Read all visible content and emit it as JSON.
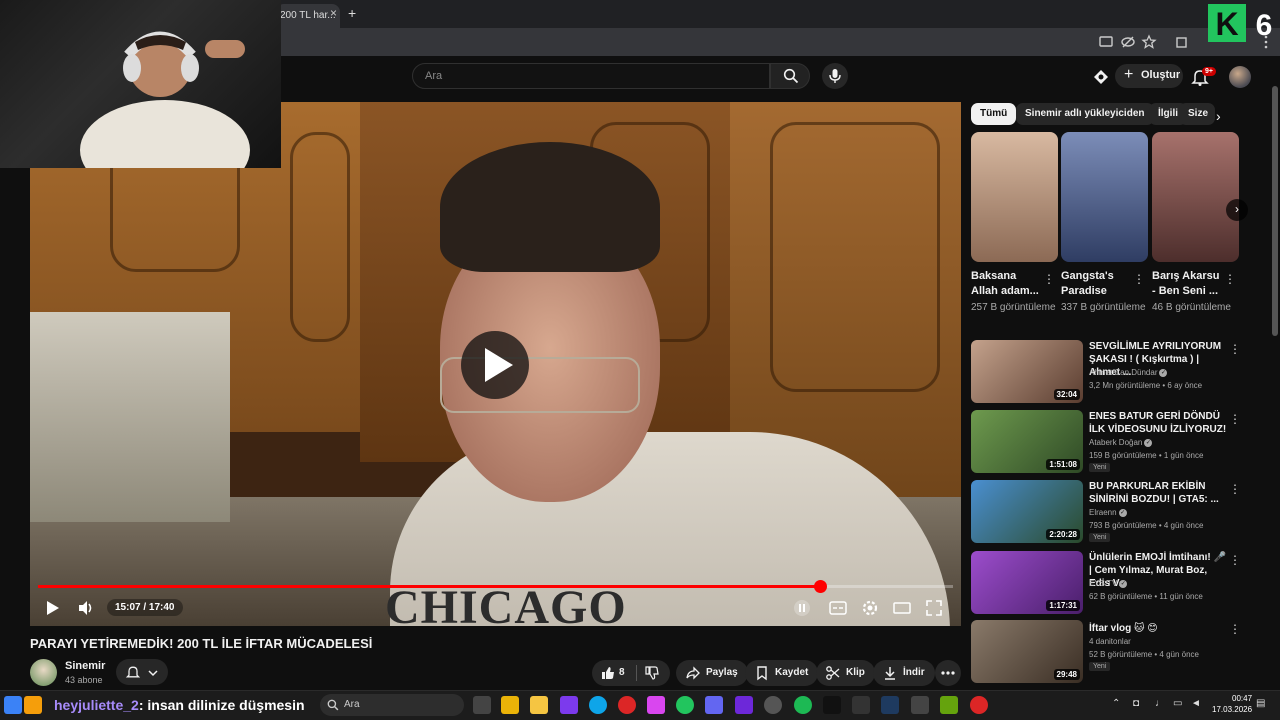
{
  "browser": {
    "tab_title": "200 TL har...",
    "tab_close": "×",
    "new_tab": "+"
  },
  "header": {
    "search_placeholder": "Ara",
    "create_label": "Oluştur",
    "notification_count": "9+"
  },
  "overlay": {
    "k6_letter": "K",
    "k6_number": "6"
  },
  "player": {
    "time": "15:07 / 17:40",
    "progress_fraction": 0.855,
    "shirt_text": "CHICAGO"
  },
  "video": {
    "title": "PARAYI YETİREMEDİK! 200 TL İLE İFTAR MÜCADELESİ",
    "channel": "Sinemir",
    "subscribers": "43 abone",
    "like_count": "8",
    "share_label": "Paylaş",
    "save_label": "Kaydet",
    "clip_label": "Klip",
    "download_label": "İndir"
  },
  "sidebar": {
    "chips": [
      "Tümü",
      "Sinemir adlı yükleyiciden",
      "İlgili",
      "Size"
    ],
    "shorts": [
      {
        "title": "Baksana Allah adam...",
        "views": "257 B görüntüleme",
        "color": "#c9a58a"
      },
      {
        "title": "Gangsta's Paradise",
        "views": "337 B görüntüleme",
        "color": "#3b5c8a"
      },
      {
        "title": "Barış Akarsu - Ben Seni ...",
        "views": "46 B görüntüleme",
        "color": "#7a4d4a"
      }
    ],
    "recommendations": [
      {
        "title": "SEVGİLİMLE AYRILIYORUM ŞAKASI ! ( Kışkırtma ) | Ahmet ...",
        "channel": "Ahmet Can Dündar",
        "meta": "3,2 Mn görüntüleme • 6 ay önce",
        "duration": "32:04",
        "badge": "",
        "color": "#8a6f5e"
      },
      {
        "title": "ENES BATUR GERİ DÖNDÜ İLK VİDEOSUNU İZLİYORUZ!",
        "channel": "Ataberk Doğan",
        "meta": "159 B görüntüleme • 1 gün önce",
        "duration": "1:51:08",
        "badge": "Yeni",
        "color": "#5b7a3a"
      },
      {
        "title": "BU PARKURLAR EKİBİN SİNİRİNİ BOZDU! | GTA5: ...",
        "channel": "Elraenn",
        "meta": "793 B görüntüleme • 4 gün önce",
        "duration": "2:20:28",
        "badge": "Yeni",
        "color": "#3a7ab8"
      },
      {
        "title": "Ünlülerin EMOJİ İmtihanı! 🎤 | Cem Yılmaz, Murat Boz, Edis V...",
        "channel": "EYS TV",
        "meta": "62 B görüntüleme • 11 gün önce",
        "duration": "1:17:31",
        "badge": "",
        "color": "#8a3ab8"
      },
      {
        "title": "İftar vlog 🐱 😊",
        "channel": "4 danitonlar",
        "meta": "52 B görüntüleme • 4 gün önce",
        "duration": "29:48",
        "badge": "Yeni",
        "color": "#6a5a4a"
      }
    ],
    "sinemir_chip_label": "Sinemir adlı yükleyiciden"
  },
  "taskbar": {
    "search_label": "Ara",
    "stream_username": "heyjuliette_2",
    "stream_message": ": insan dilinize düşmesin",
    "time": "00:47",
    "date": "17.03.2026"
  }
}
